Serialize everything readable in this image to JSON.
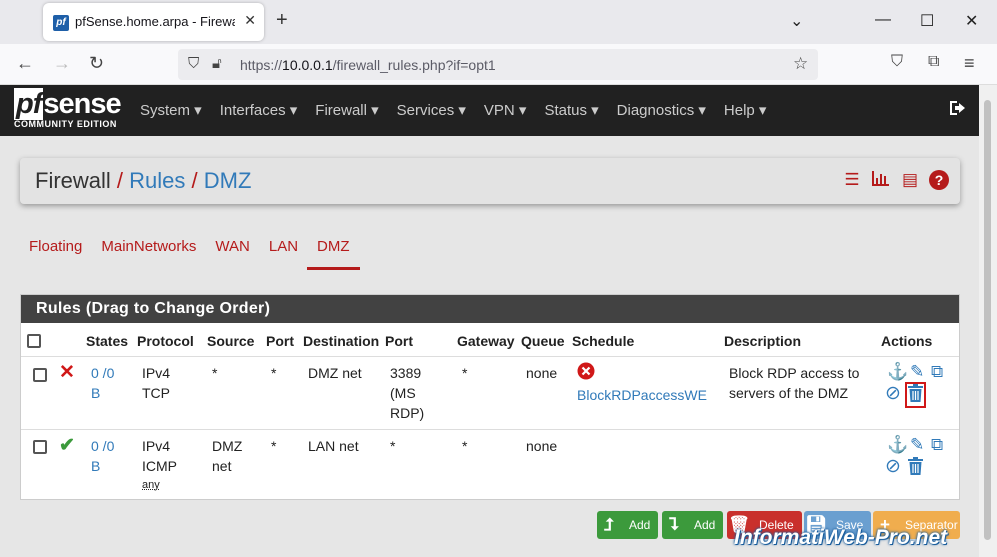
{
  "browser": {
    "tab_title": "pfSense.home.arpa - Firewall: R",
    "favicon": "pf",
    "url_prefix": "https://",
    "url_host": "10.0.0.1",
    "url_path": "/firewall_rules.php?if=opt1"
  },
  "header": {
    "logo_text": "sense",
    "logo_pf": "pf",
    "logo_sub": "COMMUNITY EDITION",
    "menu": [
      {
        "label": "System ▾"
      },
      {
        "label": "Interfaces ▾"
      },
      {
        "label": "Firewall ▾"
      },
      {
        "label": "Services ▾"
      },
      {
        "label": "VPN ▾"
      },
      {
        "label": "Status ▾"
      },
      {
        "label": "Diagnostics ▾"
      },
      {
        "label": "Help ▾"
      }
    ]
  },
  "breadcrumb": {
    "part1": "Firewall",
    "part2": "Rules",
    "part3": "DMZ",
    "separator": "/"
  },
  "tabs": [
    {
      "label": "Floating"
    },
    {
      "label": "MainNetworks"
    },
    {
      "label": "WAN"
    },
    {
      "label": "LAN"
    },
    {
      "label": "DMZ",
      "active": true
    }
  ],
  "rules_panel": {
    "title": "Rules (Drag to Change Order)",
    "columns": [
      "States",
      "Protocol",
      "Source",
      "Port",
      "Destination",
      "Port",
      "Gateway",
      "Queue",
      "Schedule",
      "Description",
      "Actions"
    ],
    "rows": [
      {
        "status": "block",
        "states_1": "0 /0",
        "states_2": "B",
        "protocol_1": "IPv4",
        "protocol_2": "TCP",
        "source": "*",
        "src_port": "*",
        "destination": "DMZ net",
        "dst_port_1": "3389",
        "dst_port_2": "(MS",
        "dst_port_3": "RDP)",
        "gateway": "*",
        "queue": "none",
        "schedule": "BlockRDPaccessWE",
        "description_1": "Block RDP access to",
        "description_2": "servers of the DMZ"
      },
      {
        "status": "pass",
        "states_1": "0 /0",
        "states_2": "B",
        "protocol_1": "IPv4",
        "protocol_2": "ICMP",
        "protocol_3": "any",
        "source_1": "DMZ",
        "source_2": "net",
        "src_port": "*",
        "destination": "LAN net",
        "dst_port_1": "*",
        "gateway": "*",
        "queue": "none",
        "schedule": "",
        "description_1": ""
      }
    ]
  },
  "buttons": {
    "add_top": "Add",
    "add_bottom": "Add",
    "delete": "Delete",
    "save": "Save",
    "separator": "Separator"
  },
  "watermark": "InformatiWeb-Pro.net",
  "colors": {
    "brand_red": "#b51b1b",
    "link_blue": "#317ab9",
    "header_dark": "#212121",
    "btn_green": "#3c9a3c",
    "btn_red": "#c9302c",
    "btn_blue": "#337ab7",
    "btn_orange": "#f0ad4e"
  }
}
